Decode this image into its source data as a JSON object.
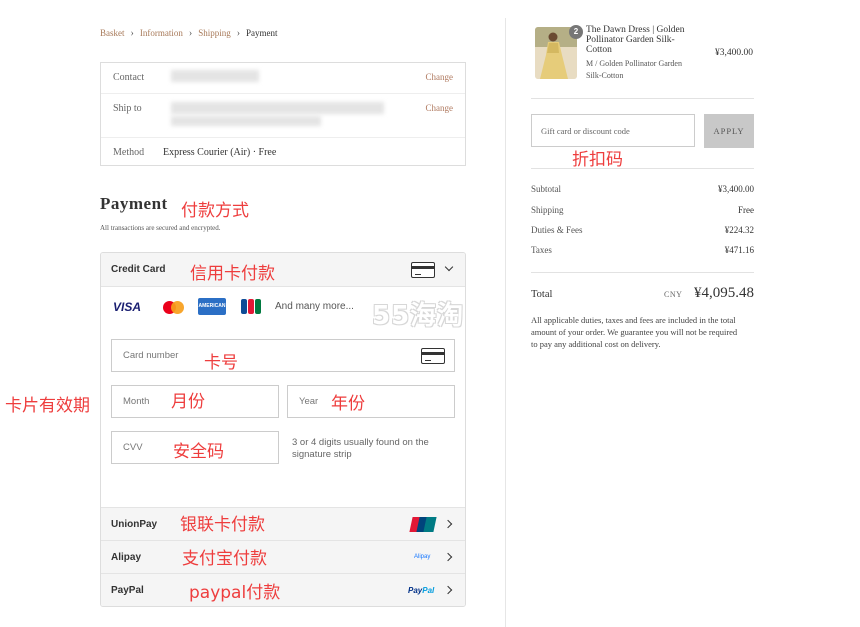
{
  "breadcrumb": {
    "items": [
      "Basket",
      "Information",
      "Shipping",
      "Payment"
    ],
    "separator": "›"
  },
  "info": {
    "contact_label": "Contact",
    "change_label": "Change",
    "ship_label": "Ship to",
    "method_label": "Method",
    "method_value": "Express Courier (Air) · Free"
  },
  "payment": {
    "title": "Payment",
    "subtitle": "All transactions are secured and encrypted.",
    "credit_card_label": "Credit Card",
    "brands": {
      "visa": "VISA",
      "amex": "AMERICAN EXPRESS",
      "jcb": "JCB",
      "more": "And many more..."
    },
    "card_number_placeholder": "Card number",
    "month_placeholder": "Month",
    "year_placeholder": "Year",
    "cvv_placeholder": "CVV",
    "cvv_hint": "3 or 4 digits usually found on the signature strip",
    "methods": [
      {
        "label": "UnionPay",
        "logo": "unionpay-logo"
      },
      {
        "label": "Alipay",
        "logo": "alipay-logo",
        "logo_text": "Alipay"
      },
      {
        "label": "PayPal",
        "logo": "paypal-logo",
        "logo_text_a": "Pay",
        "logo_text_b": "Pal"
      }
    ]
  },
  "annotations": {
    "payment_method": "付款方式",
    "credit_card": "信用卡付款",
    "card_number": "卡号",
    "expiry": "卡片有效期",
    "month": "月份",
    "year": "年份",
    "cvv": "安全码",
    "unionpay": "银联卡付款",
    "alipay": "支付宝付款",
    "paypal": "paypal付款",
    "discount": "折扣码"
  },
  "watermark": "55海淘",
  "order": {
    "quantity": "2",
    "product_name": "The Dawn Dress | Golden Pollinator Garden Silk-Cotton",
    "product_variant": "M / Golden Pollinator Garden Silk-Cotton",
    "product_price": "¥3,400.00",
    "gift_placeholder": "Gift card or discount code",
    "apply_label": "APPLY",
    "summary": [
      {
        "label": "Subtotal",
        "value": "¥3,400.00"
      },
      {
        "label": "Shipping",
        "value": "Free"
      },
      {
        "label": "Duties & Fees",
        "value": "¥224.32"
      },
      {
        "label": "Taxes",
        "value": "¥471.16"
      }
    ],
    "total_label": "Total",
    "total_currency": "CNY",
    "total_value": "¥4,095.48",
    "total_note": "All applicable duties, taxes and fees are included in the total amount of your order. We guarantee you will not be required to pay any additional cost on delivery."
  },
  "colors": {
    "accent_link": "#b07a60",
    "annotation": "#ee3d3d",
    "apply_bg": "#c8c8c8"
  }
}
